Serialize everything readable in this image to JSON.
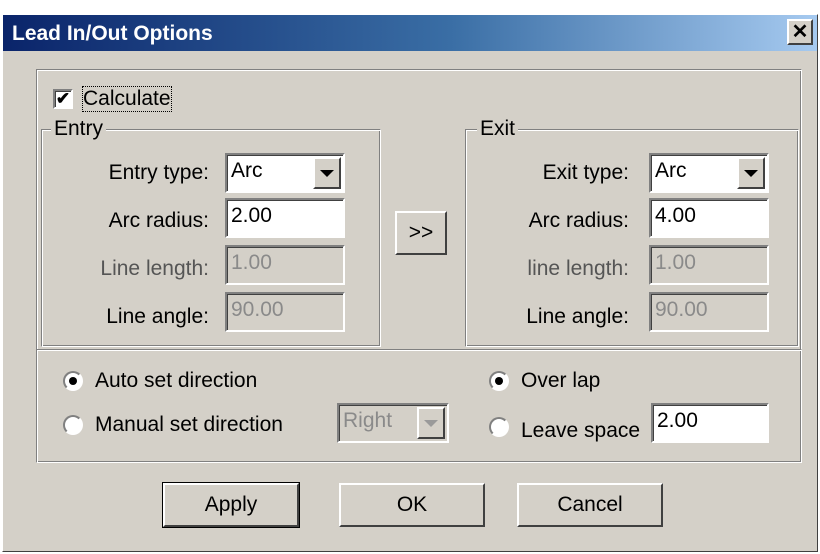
{
  "dialog": {
    "title": "Lead In/Out Options",
    "close_glyph": "✕"
  },
  "calculate": {
    "label": "Calculate",
    "checked": true,
    "check_glyph": "✔"
  },
  "entry": {
    "group_label": "Entry",
    "type_label": "Entry type:",
    "type_value": "Arc",
    "arc_radius_label": "Arc radius:",
    "arc_radius_value": "2.00",
    "line_length_label": "Line length:",
    "line_length_value": "1.00",
    "line_angle_label": "Line angle:",
    "line_angle_value": "90.00"
  },
  "copy_button": {
    "label": ">>"
  },
  "exit": {
    "group_label": "Exit",
    "type_label": "Exit type:",
    "type_value": "Arc",
    "arc_radius_label": "Arc radius:",
    "arc_radius_value": "4.00",
    "line_length_label": "line length:",
    "line_length_value": "1.00",
    "line_angle_label": "Line angle:",
    "line_angle_value": "90.00"
  },
  "direction": {
    "auto_label": "Auto set direction",
    "auto_selected": true,
    "manual_label": "Manual set direction",
    "manual_selected": false,
    "side_value": "Right"
  },
  "overlap": {
    "over_lap_label": "Over lap",
    "over_lap_selected": true,
    "leave_space_label": "Leave space",
    "leave_space_selected": false,
    "leave_space_value": "2.00"
  },
  "buttons": {
    "apply": "Apply",
    "ok": "OK",
    "cancel": "Cancel"
  }
}
